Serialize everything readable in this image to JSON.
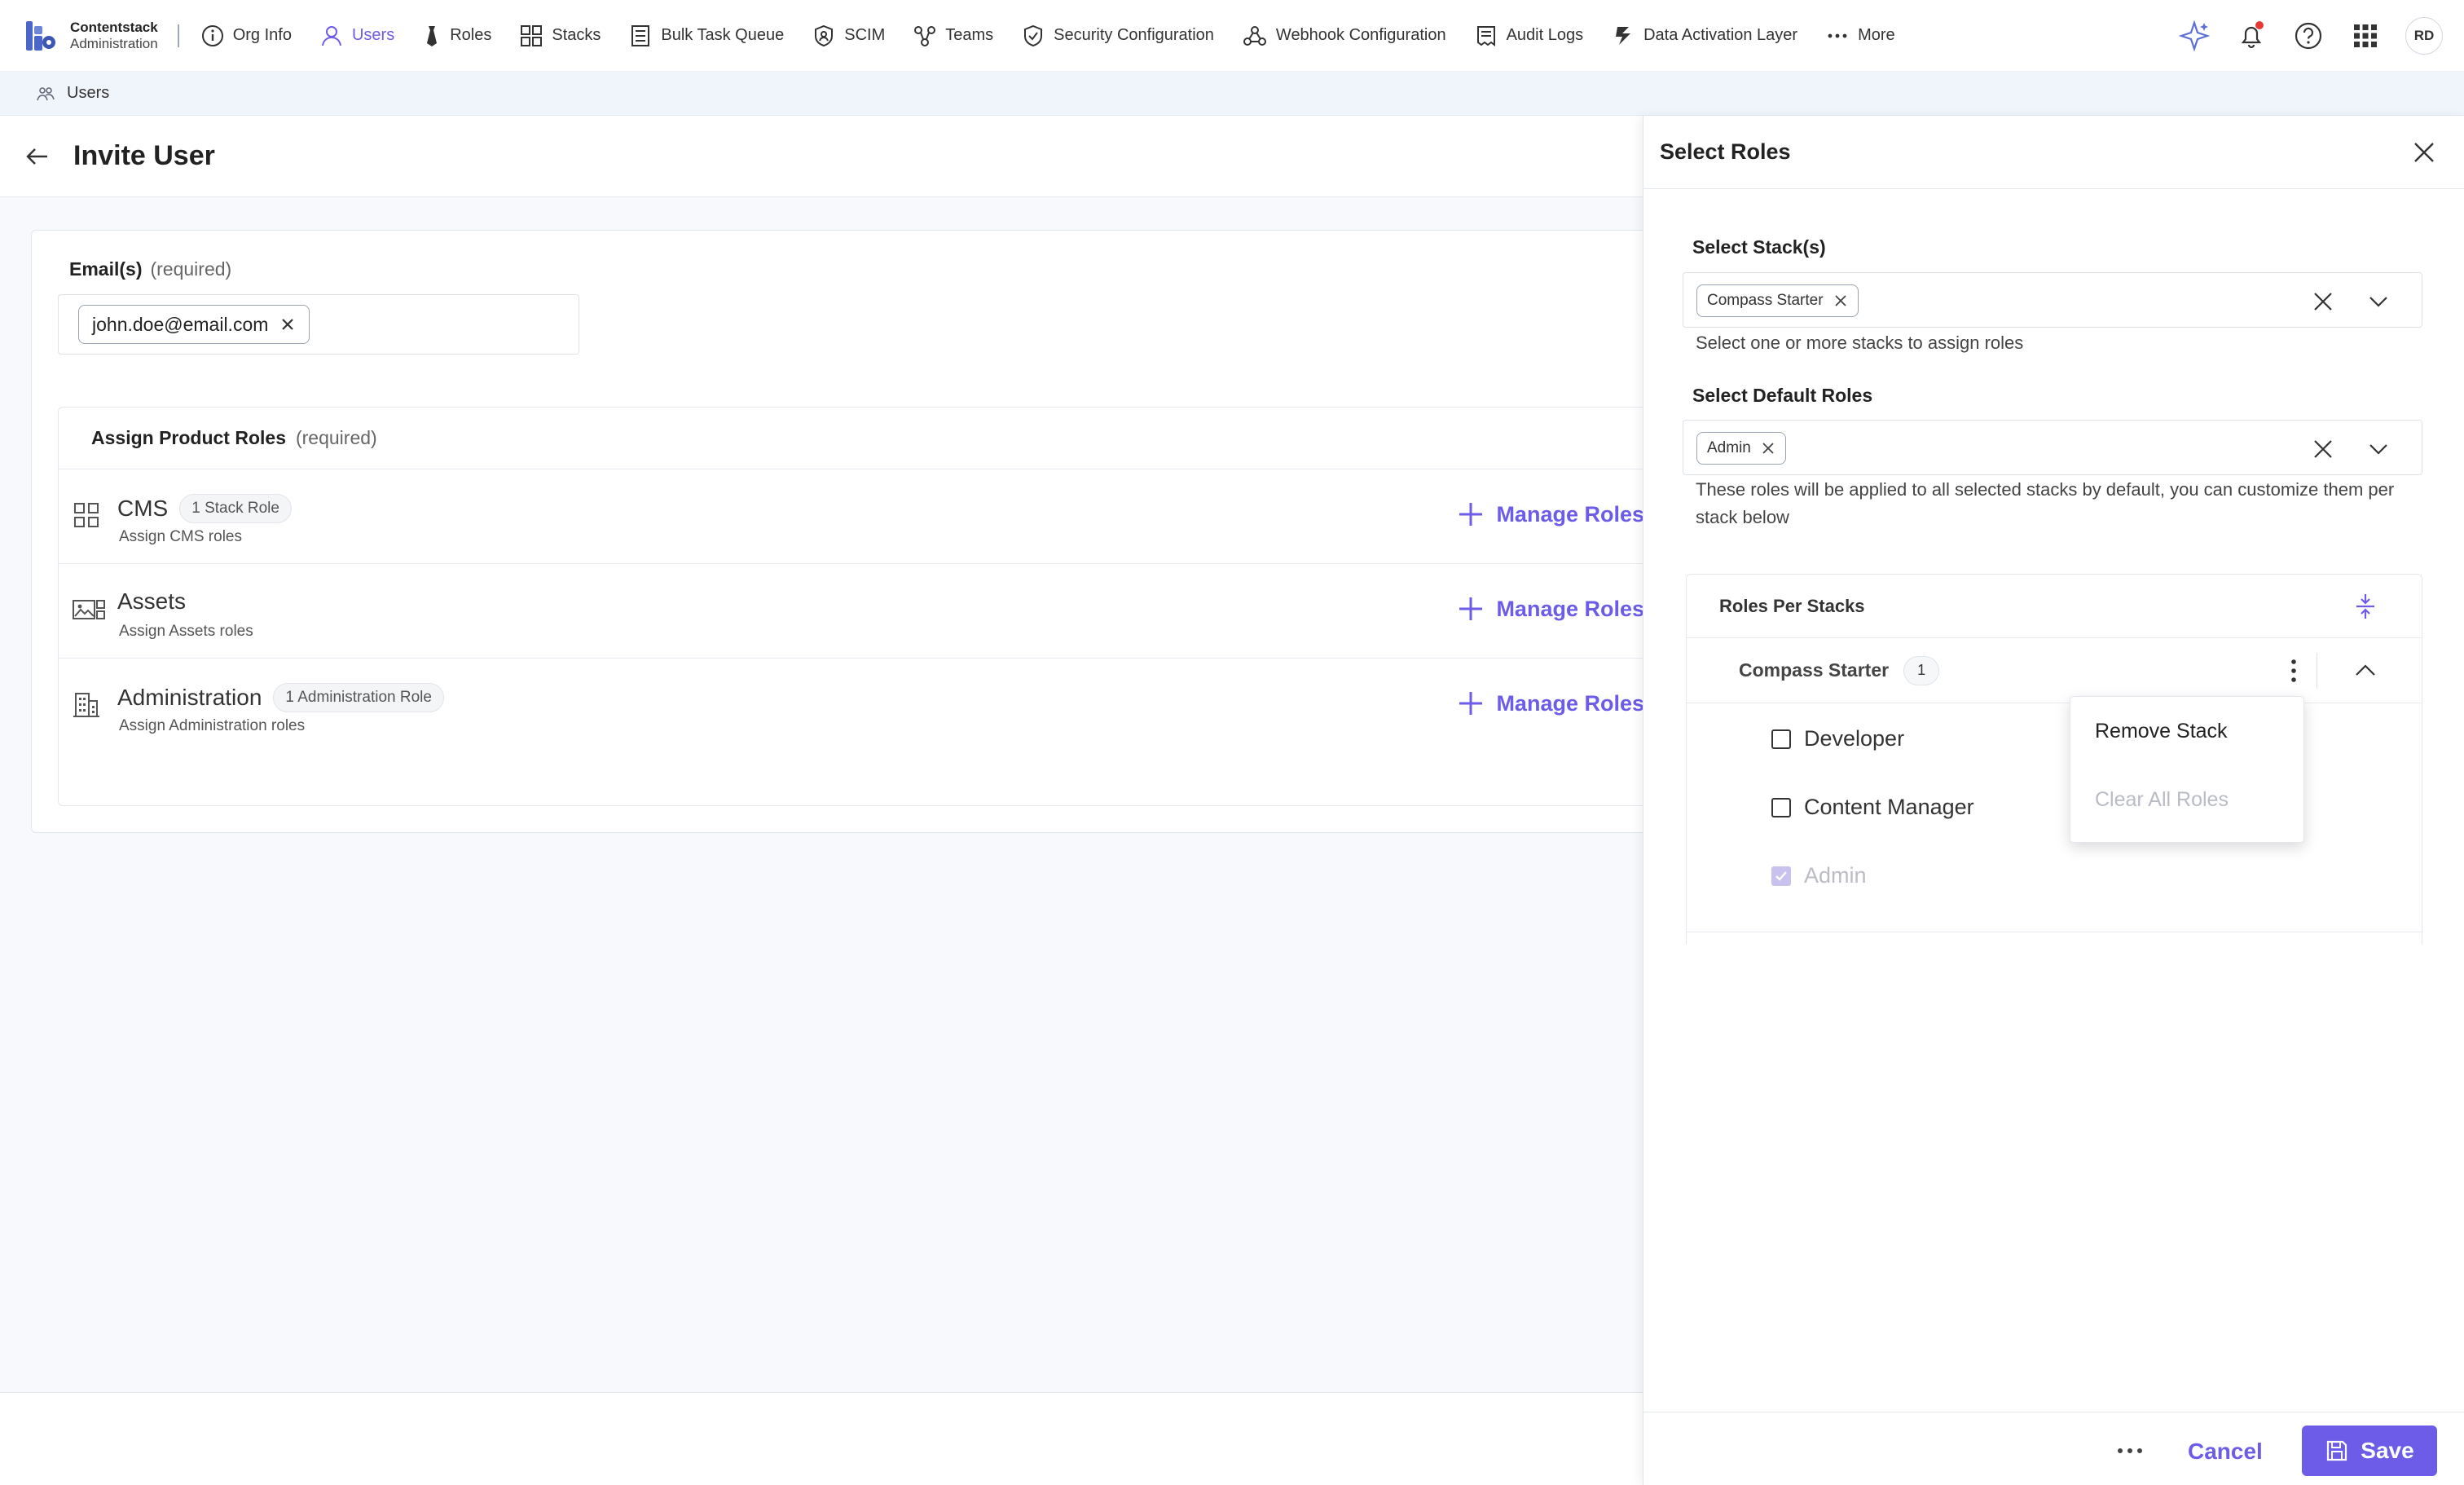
{
  "brand": {
    "name": "Contentstack",
    "sub": "Administration"
  },
  "nav": {
    "items": [
      {
        "label": "Org Info"
      },
      {
        "label": "Users"
      },
      {
        "label": "Roles"
      },
      {
        "label": "Stacks"
      },
      {
        "label": "Bulk Task Queue"
      },
      {
        "label": "SCIM"
      },
      {
        "label": "Teams"
      },
      {
        "label": "Security Configuration"
      },
      {
        "label": "Webhook Configuration"
      },
      {
        "label": "Audit Logs"
      },
      {
        "label": "Data Activation Layer"
      },
      {
        "label": "More"
      }
    ],
    "avatar_initials": "RD"
  },
  "breadcrumb": {
    "label": "Users"
  },
  "page": {
    "title": "Invite User"
  },
  "emails": {
    "label": "Email(s)",
    "required": "(required)",
    "chips": [
      "john.doe@email.com"
    ]
  },
  "product_roles": {
    "title": "Assign Product Roles",
    "required": "(required)",
    "products": [
      {
        "name": "CMS",
        "badge": "1 Stack Role",
        "sub": "Assign CMS roles",
        "action": "Manage Roles"
      },
      {
        "name": "Assets",
        "badge": "",
        "sub": "Assign Assets roles",
        "action": "Manage Roles"
      },
      {
        "name": "Administration",
        "badge": "1 Administration Role",
        "sub": "Assign Administration roles",
        "action": "Manage Roles"
      }
    ]
  },
  "drawer": {
    "title": "Select Roles",
    "stacks": {
      "label": "Select Stack(s)",
      "chips": [
        "Compass Starter"
      ],
      "help": "Select one or more stacks to assign roles"
    },
    "default_roles": {
      "label": "Select Default Roles",
      "chips": [
        "Admin"
      ],
      "help": "These roles will be applied to all selected stacks by default, you can customize them per stack below"
    },
    "roles_per_stacks": {
      "title": "Roles Per Stacks",
      "stack": {
        "name": "Compass Starter",
        "count": "1",
        "roles": [
          {
            "label": "Developer",
            "checked": false,
            "disabled": false
          },
          {
            "label": "Content Manager",
            "checked": false,
            "disabled": false
          },
          {
            "label": "Admin",
            "checked": true,
            "disabled": true
          }
        ]
      }
    },
    "menu": {
      "items": [
        {
          "label": "Remove Stack",
          "disabled": false
        },
        {
          "label": "Clear All Roles",
          "disabled": true
        }
      ]
    },
    "footer": {
      "cancel": "Cancel",
      "save": "Save"
    }
  },
  "colors": {
    "accent": "#6c5ce7",
    "notification": "#e53935"
  }
}
